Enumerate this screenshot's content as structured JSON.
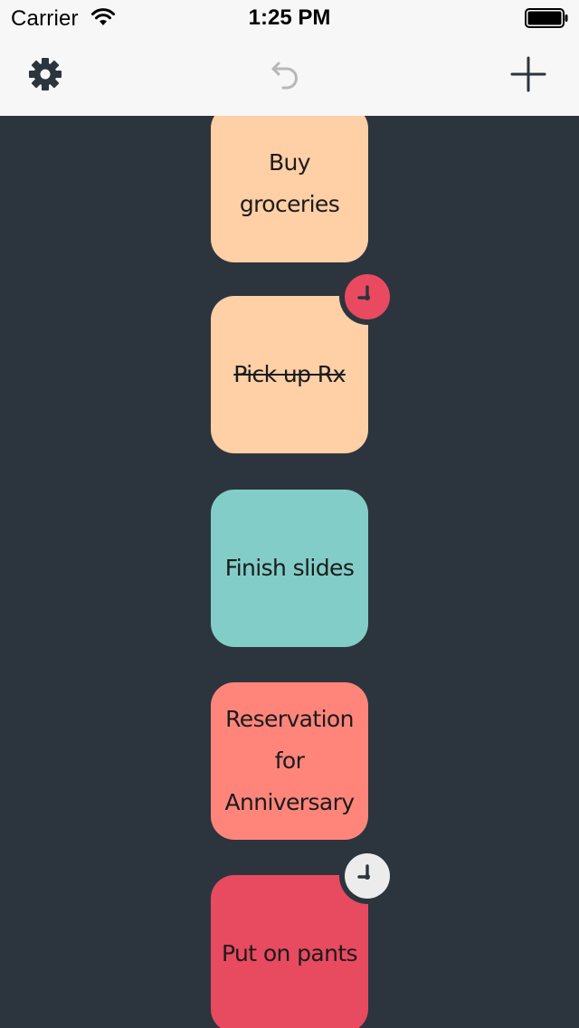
{
  "status_bar": {
    "carrier": "Carrier",
    "time": "1:25 PM",
    "icons": [
      "wifi-icon",
      "battery-icon"
    ]
  },
  "toolbar": {
    "icons": [
      "gear-icon",
      "undo-icon",
      "plus-icon"
    ],
    "color": "#2c353d",
    "undo_color": "#b7b7b7"
  },
  "tasks": [
    {
      "text": "Buy groceries",
      "color": "#ffcfa6",
      "done": false,
      "reminder": null
    },
    {
      "text": "Pick up Rx",
      "color": "#ffcfa6",
      "done": true,
      "reminder": {
        "icon": "clock-icon",
        "color": "#e94a60"
      }
    },
    {
      "text": "Finish slides",
      "color": "#82cdc8",
      "done": false,
      "reminder": null
    },
    {
      "text": "Reservation for Anniversary",
      "color": "#ff857b",
      "done": false,
      "reminder": null
    },
    {
      "text": "Put on pants",
      "color": "#e84a60",
      "done": false,
      "reminder": {
        "icon": "clock-icon",
        "color": "#ececec"
      }
    }
  ],
  "background_color": "#2c353d"
}
